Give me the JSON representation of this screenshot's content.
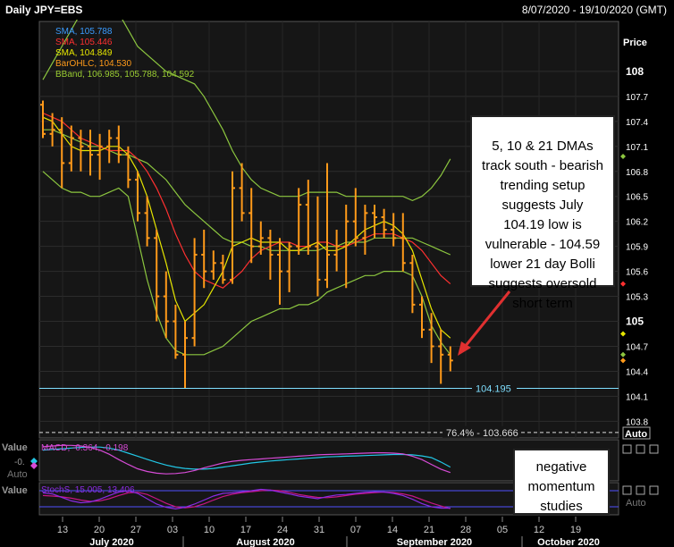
{
  "header": {
    "title": "Daily JPY=EBS",
    "date_range": "8/07/2020 - 19/10/2020 (GMT)"
  },
  "price_axis_label": "Price",
  "auto_label": "Auto",
  "legend": [
    {
      "text": "SMA, 105.788",
      "color": "#3a9cff"
    },
    {
      "text": "SMA, 105.446",
      "color": "#ff3030"
    },
    {
      "text": "SMA, 104.849",
      "color": "#e6e600"
    },
    {
      "text": "BarOHLC, 104.530",
      "color": "#ff9a1a"
    },
    {
      "text": "BBand, 106.985, 105.788, 104.592",
      "color": "#9acd32"
    }
  ],
  "ref_lines": [
    {
      "label": "104.195",
      "value": 104.195,
      "color": "#7fdfff"
    },
    {
      "label": "76.4% - 103.666",
      "value": 103.666,
      "color": "#dddddd"
    }
  ],
  "annotations": {
    "main": "5, 10 & 21 DMAs track south - bearish trending setup suggests July 104.19 low is vulnerable - 104.59 lower 21 day Bolli suggests oversold short term",
    "momentum": "negative momentum studies"
  },
  "macd": {
    "label": "MACD, -0.364, -0.198",
    "value_label": "Value",
    "value_text": "-0.",
    "auto": "Auto"
  },
  "stoch": {
    "label": "StochS, 15.005, 13.406",
    "value_label": "Value",
    "auto": "Auto"
  },
  "x_axis": {
    "day_ticks": [
      "13",
      "20",
      "27",
      "03",
      "10",
      "17",
      "24",
      "31",
      "07",
      "14",
      "21",
      "28",
      "05",
      "12",
      "19"
    ],
    "months": [
      "July 2020",
      "August 2020",
      "September 2020",
      "October 2020"
    ]
  },
  "chart_data": {
    "type": "bar",
    "y_ticks": [
      103.8,
      104.1,
      104.4,
      104.7,
      105,
      105.3,
      105.6,
      105.9,
      106.2,
      106.5,
      106.8,
      107.1,
      107.4,
      107.7,
      108
    ],
    "ylim": [
      103.6,
      108.6
    ],
    "ohlc": [
      {
        "o": 107.6,
        "h": 107.65,
        "l": 107.2,
        "c": 107.25
      },
      {
        "o": 107.25,
        "h": 107.5,
        "l": 107.1,
        "c": 107.3
      },
      {
        "o": 107.3,
        "h": 107.45,
        "l": 106.6,
        "c": 106.9
      },
      {
        "o": 106.9,
        "h": 107.35,
        "l": 106.8,
        "c": 107.2
      },
      {
        "o": 107.2,
        "h": 107.3,
        "l": 106.8,
        "c": 107.1
      },
      {
        "o": 107.1,
        "h": 107.3,
        "l": 106.75,
        "c": 107.0
      },
      {
        "o": 107.0,
        "h": 107.25,
        "l": 106.7,
        "c": 107.1
      },
      {
        "o": 107.1,
        "h": 107.3,
        "l": 106.9,
        "c": 107.2
      },
      {
        "o": 107.2,
        "h": 107.35,
        "l": 106.9,
        "c": 107.0
      },
      {
        "o": 107.0,
        "h": 107.1,
        "l": 106.6,
        "c": 106.7
      },
      {
        "o": 106.7,
        "h": 106.8,
        "l": 106.2,
        "c": 106.3
      },
      {
        "o": 106.3,
        "h": 106.5,
        "l": 105.9,
        "c": 106.0
      },
      {
        "o": 106.0,
        "h": 106.1,
        "l": 105.0,
        "c": 105.3
      },
      {
        "o": 105.3,
        "h": 105.6,
        "l": 104.8,
        "c": 105.0
      },
      {
        "o": 105.0,
        "h": 105.2,
        "l": 104.55,
        "c": 104.6
      },
      {
        "o": 104.6,
        "h": 105.0,
        "l": 104.2,
        "c": 104.8
      },
      {
        "o": 104.8,
        "h": 106.0,
        "l": 104.7,
        "c": 105.8
      },
      {
        "o": 105.8,
        "h": 106.1,
        "l": 105.4,
        "c": 105.6
      },
      {
        "o": 105.6,
        "h": 105.85,
        "l": 105.5,
        "c": 105.7
      },
      {
        "o": 105.7,
        "h": 105.8,
        "l": 105.45,
        "c": 105.5
      },
      {
        "o": 105.5,
        "h": 106.8,
        "l": 105.45,
        "c": 106.6
      },
      {
        "o": 106.6,
        "h": 106.9,
        "l": 106.2,
        "c": 106.3
      },
      {
        "o": 106.3,
        "h": 106.6,
        "l": 105.7,
        "c": 105.9
      },
      {
        "o": 105.9,
        "h": 106.2,
        "l": 105.8,
        "c": 106.0
      },
      {
        "o": 106.0,
        "h": 106.1,
        "l": 105.5,
        "c": 105.8
      },
      {
        "o": 105.8,
        "h": 106.0,
        "l": 105.2,
        "c": 105.6
      },
      {
        "o": 105.6,
        "h": 105.95,
        "l": 105.35,
        "c": 105.9
      },
      {
        "o": 105.9,
        "h": 106.6,
        "l": 105.8,
        "c": 106.4
      },
      {
        "o": 106.4,
        "h": 106.7,
        "l": 105.8,
        "c": 105.9
      },
      {
        "o": 105.9,
        "h": 106.5,
        "l": 105.3,
        "c": 105.5
      },
      {
        "o": 105.5,
        "h": 106.9,
        "l": 105.4,
        "c": 105.8
      },
      {
        "o": 105.8,
        "h": 106.1,
        "l": 105.6,
        "c": 105.9
      },
      {
        "o": 105.9,
        "h": 106.4,
        "l": 105.4,
        "c": 106.2
      },
      {
        "o": 106.2,
        "h": 106.6,
        "l": 105.9,
        "c": 106.0
      },
      {
        "o": 106.0,
        "h": 106.4,
        "l": 105.8,
        "c": 106.3
      },
      {
        "o": 106.3,
        "h": 106.4,
        "l": 106.0,
        "c": 106.25
      },
      {
        "o": 106.25,
        "h": 106.35,
        "l": 106.0,
        "c": 106.1
      },
      {
        "o": 106.1,
        "h": 106.3,
        "l": 105.9,
        "c": 106.0
      },
      {
        "o": 106.0,
        "h": 106.3,
        "l": 105.6,
        "c": 105.7
      },
      {
        "o": 105.7,
        "h": 105.8,
        "l": 105.1,
        "c": 105.2
      },
      {
        "o": 105.2,
        "h": 105.3,
        "l": 104.8,
        "c": 104.9
      },
      {
        "o": 104.9,
        "h": 105.1,
        "l": 104.5,
        "c": 104.7
      },
      {
        "o": 104.7,
        "h": 104.9,
        "l": 104.25,
        "c": 104.6
      },
      {
        "o": 104.6,
        "h": 104.7,
        "l": 104.4,
        "c": 104.53
      }
    ],
    "sma5": [
      107.45,
      107.4,
      107.25,
      107.1,
      107.05,
      107.05,
      107.05,
      107.1,
      107.1,
      107.0,
      106.8,
      106.5,
      106.1,
      105.7,
      105.25,
      105.0,
      105.1,
      105.2,
      105.4,
      105.6,
      105.9,
      105.95,
      106.0,
      105.95,
      105.95,
      105.95,
      105.85,
      105.85,
      105.9,
      105.95,
      105.85,
      105.85,
      105.9,
      106.0,
      106.1,
      106.15,
      106.2,
      106.15,
      106.05,
      105.85,
      105.5,
      105.15,
      104.9,
      104.8
    ],
    "sma10": [
      107.5,
      107.45,
      107.4,
      107.3,
      107.2,
      107.15,
      107.1,
      107.05,
      107.05,
      107.05,
      106.95,
      106.8,
      106.6,
      106.35,
      106.05,
      105.8,
      105.6,
      105.5,
      105.45,
      105.4,
      105.5,
      105.6,
      105.75,
      105.85,
      105.9,
      105.95,
      105.95,
      105.9,
      105.9,
      105.95,
      105.95,
      105.9,
      105.9,
      105.95,
      106.0,
      106.05,
      106.05,
      106.05,
      106.0,
      105.95,
      105.85,
      105.7,
      105.55,
      105.45
    ],
    "sma21": [
      107.3,
      107.3,
      107.25,
      107.2,
      107.15,
      107.1,
      107.1,
      107.05,
      107.0,
      107.0,
      106.95,
      106.9,
      106.8,
      106.7,
      106.55,
      106.4,
      106.3,
      106.2,
      106.1,
      106.0,
      105.95,
      105.95,
      105.9,
      105.9,
      105.85,
      105.85,
      105.85,
      105.85,
      105.85,
      105.85,
      105.9,
      105.9,
      105.95,
      105.95,
      105.95,
      106.0,
      106.0,
      106.0,
      106.0,
      106.0,
      105.95,
      105.9,
      105.85,
      105.8
    ],
    "bb_upper": [
      107.9,
      108.1,
      108.3,
      108.5,
      108.7,
      108.85,
      108.95,
      108.85,
      108.7,
      108.5,
      108.3,
      108.2,
      108.1,
      108.0,
      107.95,
      107.9,
      107.85,
      107.7,
      107.5,
      107.3,
      107.05,
      106.85,
      106.7,
      106.6,
      106.55,
      106.5,
      106.5,
      106.5,
      106.55,
      106.55,
      106.55,
      106.55,
      106.5,
      106.5,
      106.5,
      106.5,
      106.5,
      106.5,
      106.5,
      106.45,
      106.5,
      106.6,
      106.75,
      106.95
    ],
    "bb_lower": [
      106.8,
      106.7,
      106.6,
      106.55,
      106.55,
      106.5,
      106.5,
      106.55,
      106.6,
      106.5,
      106.0,
      105.5,
      105.1,
      104.8,
      104.65,
      104.6,
      104.6,
      104.6,
      104.65,
      104.7,
      104.8,
      104.9,
      105.0,
      105.05,
      105.1,
      105.15,
      105.15,
      105.2,
      105.2,
      105.25,
      105.35,
      105.4,
      105.45,
      105.5,
      105.55,
      105.55,
      105.6,
      105.6,
      105.6,
      105.55,
      105.3,
      104.95,
      104.75,
      104.6
    ],
    "macd": [
      0.4,
      0.42,
      0.44,
      0.44,
      0.42,
      0.38,
      0.3,
      0.18,
      0.02,
      -0.12,
      -0.25,
      -0.33,
      -0.38,
      -0.4,
      -0.39,
      -0.36,
      -0.3,
      -0.22,
      -0.15,
      -0.08,
      -0.03,
      0.0,
      0.02,
      0.04,
      0.06,
      0.08,
      0.1,
      0.12,
      0.14,
      0.16,
      0.17,
      0.18,
      0.19,
      0.2,
      0.21,
      0.22,
      0.22,
      0.21,
      0.19,
      0.12,
      0.02,
      -0.12,
      -0.26,
      -0.36
    ],
    "macd_signal": [
      0.3,
      0.32,
      0.34,
      0.36,
      0.38,
      0.39,
      0.39,
      0.36,
      0.3,
      0.21,
      0.12,
      0.03,
      -0.06,
      -0.14,
      -0.2,
      -0.24,
      -0.26,
      -0.26,
      -0.24,
      -0.2,
      -0.16,
      -0.12,
      -0.08,
      -0.05,
      -0.02,
      0.0,
      0.02,
      0.04,
      0.06,
      0.08,
      0.1,
      0.11,
      0.12,
      0.13,
      0.14,
      0.15,
      0.16,
      0.17,
      0.17,
      0.16,
      0.13,
      0.08,
      -0.05,
      -0.2
    ],
    "stoch_k": [
      72,
      68,
      55,
      42,
      35,
      38,
      48,
      62,
      75,
      80,
      70,
      50,
      30,
      18,
      12,
      18,
      30,
      45,
      60,
      70,
      72,
      76,
      80,
      85,
      82,
      75,
      68,
      60,
      55,
      50,
      58,
      64,
      66,
      70,
      74,
      76,
      75,
      70,
      62,
      48,
      32,
      20,
      15,
      15
    ],
    "stoch_d": [
      62,
      60,
      57,
      52,
      45,
      40,
      42,
      50,
      62,
      72,
      74,
      66,
      50,
      33,
      20,
      16,
      20,
      31,
      45,
      58,
      67,
      73,
      76,
      80,
      82,
      80,
      74,
      66,
      60,
      55,
      54,
      57,
      62,
      67,
      70,
      73,
      75,
      73,
      68,
      60,
      47,
      34,
      23,
      13
    ]
  }
}
